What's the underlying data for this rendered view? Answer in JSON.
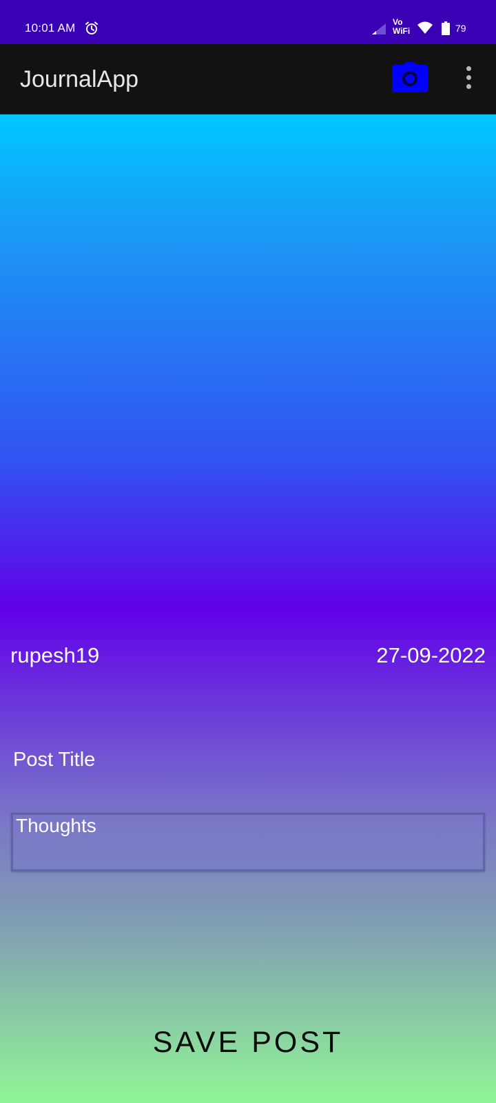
{
  "status_bar": {
    "time": "10:01 AM",
    "vowifi_top": "Vo",
    "vowifi_bottom": "WiFi",
    "battery_level": "79",
    "icons": [
      "alarm-icon",
      "signal-icon",
      "wifi-icon",
      "battery-icon"
    ]
  },
  "app_bar": {
    "title": "JournalApp",
    "actions": [
      "camera-icon",
      "overflow-menu-icon"
    ],
    "camera_color": "#0000ff"
  },
  "post": {
    "username": "rupesh19",
    "date": "27-09-2022",
    "title_placeholder": "Post Title",
    "thoughts_placeholder": "Thoughts",
    "save_label": "SAVE POST"
  },
  "colors": {
    "status_bar": "#3a00b3",
    "app_bar": "#121212",
    "gradient_top": "#00c8ff",
    "gradient_mid": "#6100e8",
    "gradient_bottom": "#91f597"
  }
}
